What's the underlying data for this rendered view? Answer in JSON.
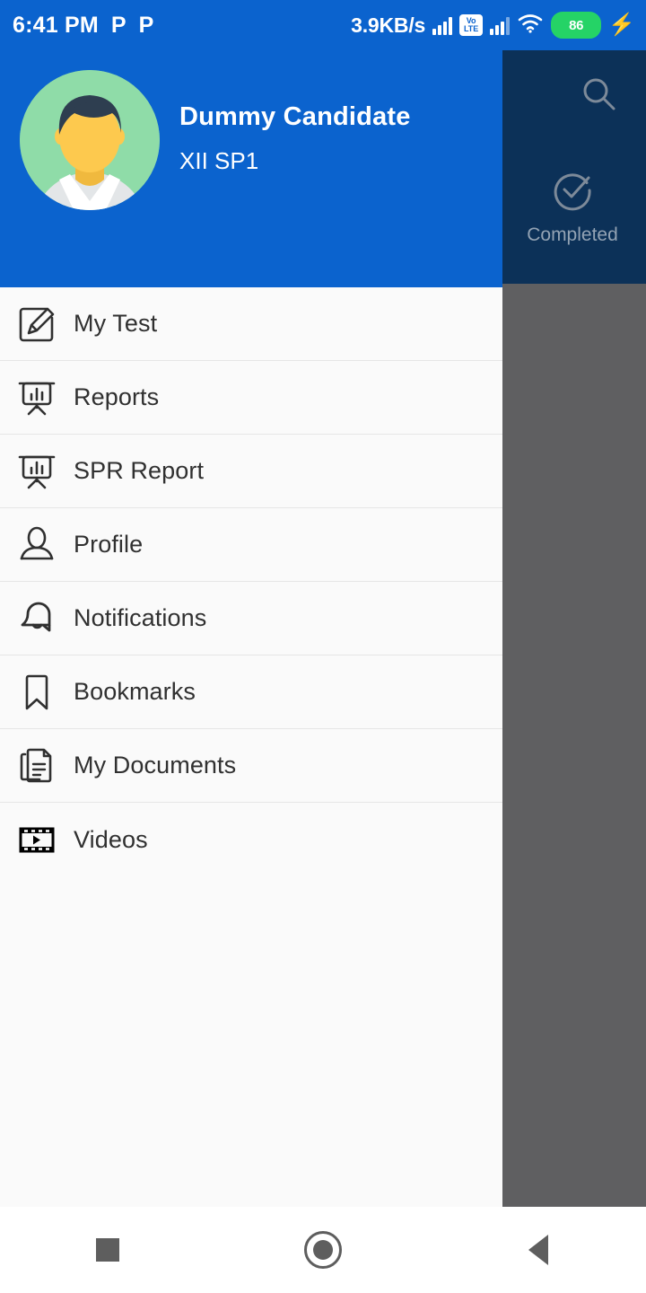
{
  "status_bar": {
    "clock": "6:41 PM",
    "notification_icons": [
      "P",
      "P"
    ],
    "network_speed": "3.9KB/s",
    "volte_top": "Vo",
    "volte_bottom": "LTE",
    "battery_level": "86",
    "battery_color": "#25D366",
    "background_color": "#0B63CE"
  },
  "background_app": {
    "app_bar_color": "#0C3158",
    "search_icon": "search-icon",
    "tab": {
      "label": "Completed",
      "icon": "check-circle-icon"
    },
    "scrim_color": "#5F5F61"
  },
  "drawer": {
    "header": {
      "background_color": "#0B63CE",
      "avatar": "user-avatar",
      "name": "Dummy Candidate",
      "subtitle": "XII SP1"
    },
    "items": [
      {
        "label": "My Test",
        "icon": "edit-square-icon"
      },
      {
        "label": "Reports",
        "icon": "presentation-chart-icon"
      },
      {
        "label": "SPR Report",
        "icon": "presentation-chart-icon"
      },
      {
        "label": "Profile",
        "icon": "user-icon"
      },
      {
        "label": "Notifications",
        "icon": "bell-icon"
      },
      {
        "label": "Bookmarks",
        "icon": "bookmark-icon"
      },
      {
        "label": "My Documents",
        "icon": "documents-icon"
      },
      {
        "label": "Videos",
        "icon": "film-play-icon"
      }
    ]
  },
  "nav_bar": {
    "recents": "recents-square",
    "home": "home-circle",
    "back": "back-triangle"
  }
}
